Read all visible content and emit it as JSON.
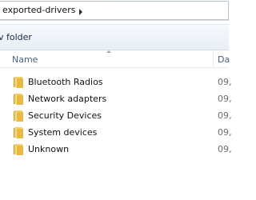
{
  "address_bar": {
    "path": "exported-drivers"
  },
  "toolbar": {
    "new_folder_label": "v folder"
  },
  "columns": {
    "name": "Name",
    "date": "Da"
  },
  "items": [
    {
      "name": "Bluetooth Radios",
      "date": "09,"
    },
    {
      "name": "Network adapters",
      "date": "09,"
    },
    {
      "name": "Security Devices",
      "date": "09,"
    },
    {
      "name": "System devices",
      "date": "09,"
    },
    {
      "name": "Unknown",
      "date": "09,"
    }
  ]
}
